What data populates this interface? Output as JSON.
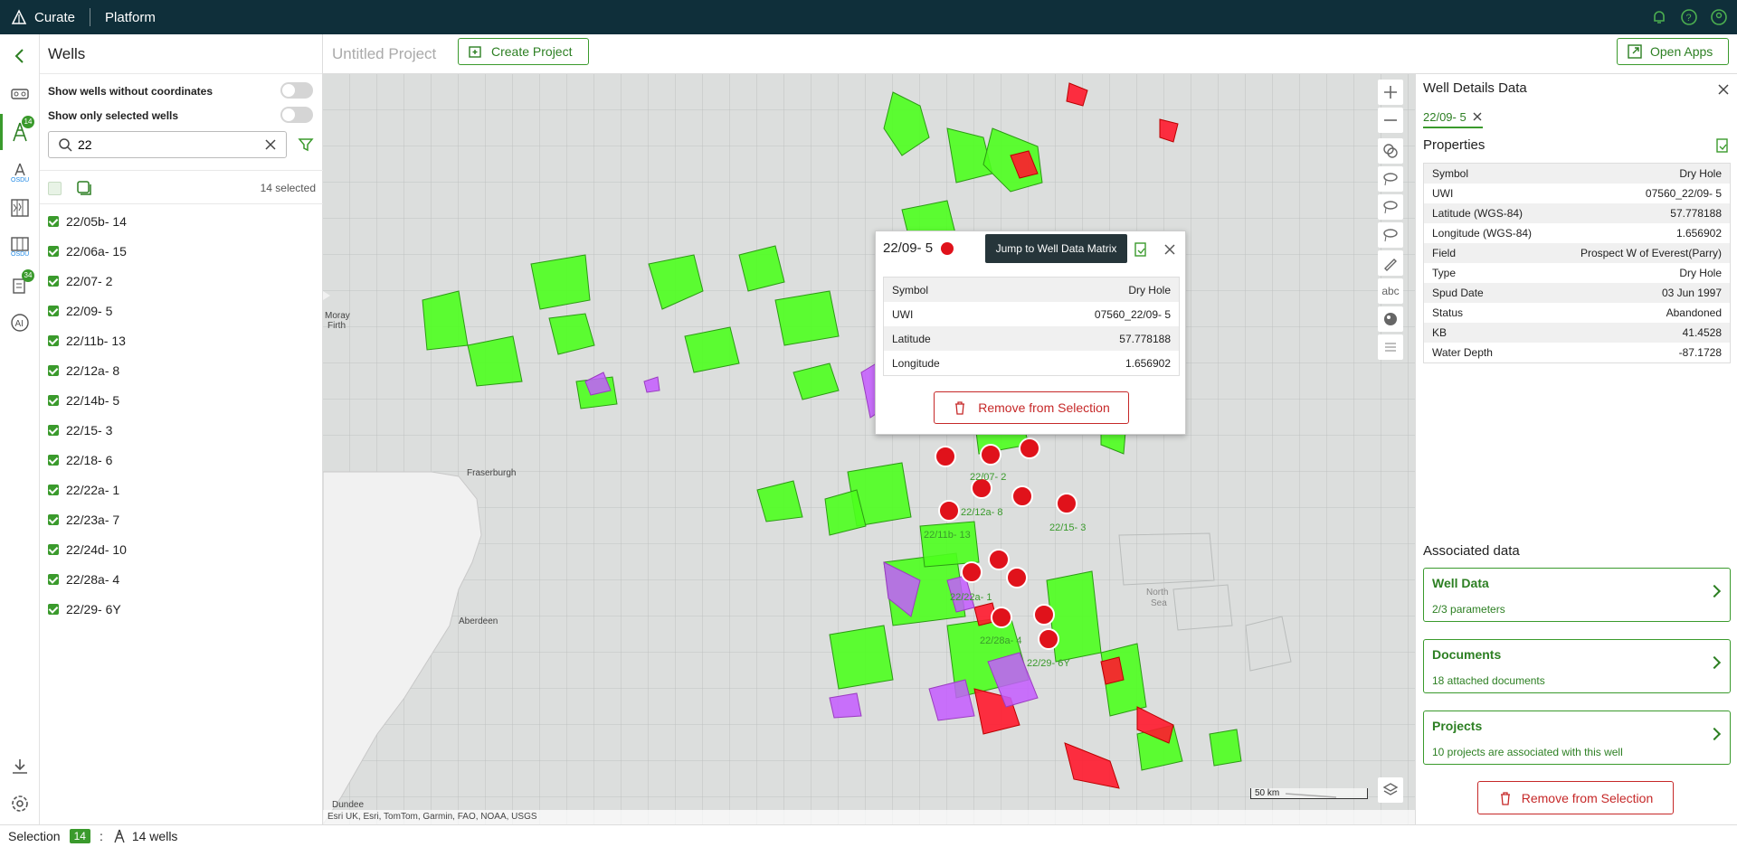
{
  "topbar": {
    "brand": "Curate",
    "platform": "Platform"
  },
  "panel": {
    "title": "Wells",
    "toggle1": "Show wells without coordinates",
    "toggle2": "Show only selected wells",
    "search_value": "22",
    "selected": "14 selected",
    "wells": [
      "22/05b- 14",
      "22/06a- 15",
      "22/07- 2",
      "22/09- 5",
      "22/11b- 13",
      "22/12a- 8",
      "22/14b- 5",
      "22/15- 3",
      "22/18- 6",
      "22/22a- 1",
      "22/23a- 7",
      "22/24d- 10",
      "22/28a- 4",
      "22/29- 6Y"
    ]
  },
  "rail": {
    "badge1": "14",
    "badge2": "34"
  },
  "project": {
    "title": "Untitled Project",
    "create": "Create Project",
    "open_apps": "Open Apps"
  },
  "map": {
    "labels": {
      "moray": "Moray",
      "firth": "Firth",
      "fraserburgh": "Fraserburgh",
      "aberdeen": "Aberdeen",
      "dundee": "Dundee",
      "north": "North",
      "sea": "Sea"
    },
    "well_labels": [
      "22/07- 2",
      "22/12a- 8",
      "22/15- 3",
      "22/11b- 13",
      "22/22a- 1",
      "22/28a- 4",
      "22/29- 6Y"
    ],
    "scale": "50 km",
    "attribution": "Esri UK, Esri, TomTom, Garmin, FAO, NOAA, USGS",
    "tools_abc": "abc"
  },
  "popup": {
    "title": "22/09- 5",
    "tooltip": "Jump to Well Data Matrix",
    "rows": [
      [
        "Symbol",
        "Dry Hole"
      ],
      [
        "UWI",
        "07560_22/09- 5"
      ],
      [
        "Latitude",
        "57.778188"
      ],
      [
        "Longitude",
        "1.656902"
      ]
    ],
    "remove": "Remove from Selection"
  },
  "details": {
    "title": "Well Details Data",
    "chip": "22/09- 5",
    "properties": "Properties",
    "rows": [
      [
        "Symbol",
        "Dry Hole"
      ],
      [
        "UWI",
        "07560_22/09- 5"
      ],
      [
        "Latitude (WGS-84)",
        "57.778188"
      ],
      [
        "Longitude (WGS-84)",
        "1.656902"
      ],
      [
        "Field",
        "Prospect W of Everest(Parry)"
      ],
      [
        "Type",
        "Dry Hole"
      ],
      [
        "Spud Date",
        "03 Jun 1997"
      ],
      [
        "Status",
        "Abandoned"
      ],
      [
        "KB",
        "41.4528"
      ],
      [
        "Water Depth",
        "-87.1728"
      ]
    ],
    "assoc_title": "Associated data",
    "assoc": [
      {
        "title": "Well Data",
        "sub": "2/3 parameters"
      },
      {
        "title": "Documents",
        "sub": "18 attached documents"
      },
      {
        "title": "Projects",
        "sub": "10 projects are associated with this well"
      }
    ],
    "remove": "Remove from Selection"
  },
  "status": {
    "label": "Selection",
    "count": "14",
    "sep": ":",
    "wells": "14 wells"
  },
  "colors": {
    "accent": "#3a9a2c",
    "topbar": "#0f2f3a",
    "danger": "#c62828",
    "well_red": "#e0121b"
  }
}
